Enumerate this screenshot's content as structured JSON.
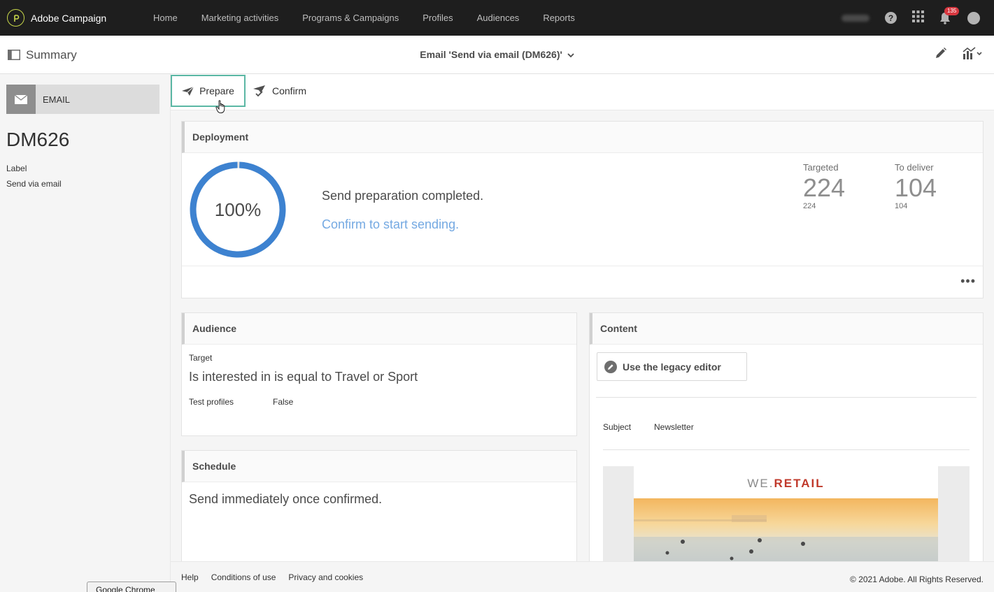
{
  "app": {
    "name": "Adobe Campaign"
  },
  "nav": [
    "Home",
    "Marketing activities",
    "Programs & Campaigns",
    "Profiles",
    "Audiences",
    "Reports"
  ],
  "topbar": {
    "notifications": "135"
  },
  "header": {
    "summary": "Summary",
    "title": "Email 'Send via email (DM626)'"
  },
  "sidebar": {
    "type": "EMAIL",
    "code": "DM626",
    "label_caption": "Label",
    "label_value": "Send via email"
  },
  "actions": {
    "prepare": "Prepare",
    "confirm": "Confirm"
  },
  "deployment": {
    "title": "Deployment",
    "progress": "100%",
    "progress_fraction": 1.0,
    "status": "Send preparation completed.",
    "link": "Confirm to start sending.",
    "targeted": {
      "label": "Targeted",
      "big": "224",
      "small": "224"
    },
    "to_deliver": {
      "label": "To deliver",
      "big": "104",
      "small": "104"
    },
    "more": "•••"
  },
  "audience": {
    "title": "Audience",
    "target_label": "Target",
    "target_value": "Is interested in is equal to Travel or Sport",
    "test_profiles_label": "Test profiles",
    "test_profiles_value": "False"
  },
  "schedule": {
    "title": "Schedule",
    "value": "Send immediately once confirmed."
  },
  "content": {
    "title": "Content",
    "legacy_button": "Use the legacy editor",
    "subject_label": "Subject",
    "subject_value": "Newsletter",
    "brand_prefix": "WE.",
    "brand_suffix": "RETAIL"
  },
  "footer": {
    "help": "Help",
    "conditions": "Conditions of use",
    "privacy": "Privacy and cookies",
    "copyright": "© 2021 Adobe. All Rights Reserved."
  },
  "chrome_tooltip": "Google Chrome",
  "colors": {
    "accent_teal": "#5bb7a4",
    "ring_blue": "#3d82d0",
    "link_blue": "#74a9e2",
    "badge_red": "#d7373f"
  }
}
